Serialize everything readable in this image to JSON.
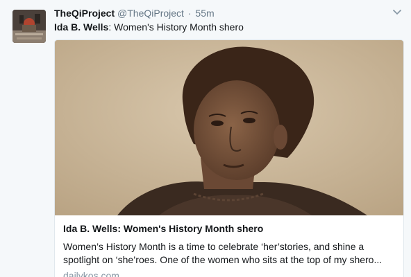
{
  "tweet": {
    "display_name": "TheQiProject",
    "handle": "@TheQiProject",
    "separator": "·",
    "time": "55m",
    "text_bold": "Ida B. Wells",
    "text_rest": ": Women's History Month shero"
  },
  "card": {
    "title": "Ida B. Wells: Women's History Month shero",
    "description_line1": "Women’s History Month is a time to celebrate ‘her’stories, and shine a",
    "description_line2": "spotlight on ‘she’roes. One of the women who sits at the top of my shero...",
    "domain": "dailykos.com"
  },
  "icons": {
    "caret": "chevron-down-icon",
    "avatar": "profile-avatar"
  },
  "colors": {
    "name": "#14171a",
    "meta": "#657786",
    "domain": "#8899a6",
    "border": "#e1e8ed",
    "background": "#f5f8fa"
  }
}
